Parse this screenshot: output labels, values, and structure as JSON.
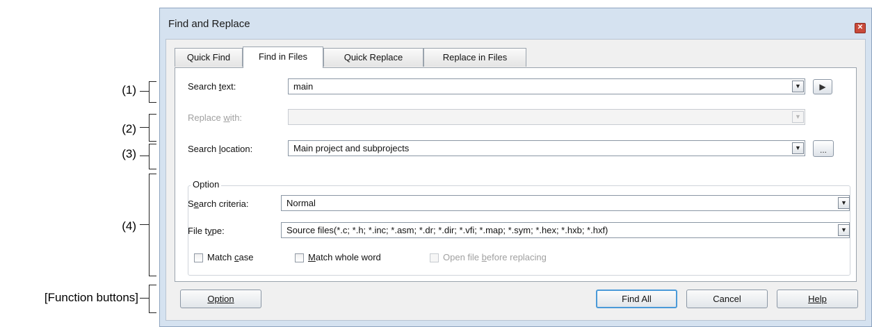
{
  "annotations": {
    "a1": "(1)",
    "a2": "(2)",
    "a3": "(3)",
    "a4": "(4)",
    "function_buttons": "[Function buttons]"
  },
  "window": {
    "title": "Find and Replace"
  },
  "tabs": [
    {
      "label": "Quick Find",
      "active": false
    },
    {
      "label": "Find in Files",
      "active": true
    },
    {
      "label": "Quick Replace",
      "active": false
    },
    {
      "label": "Replace in Files",
      "active": false
    }
  ],
  "search_text": {
    "label": "Search text:",
    "value": "main"
  },
  "replace_with": {
    "label": "Replace with:",
    "value": "",
    "disabled": true
  },
  "search_location": {
    "label": "Search location:",
    "value": "Main project and subprojects"
  },
  "option_group": {
    "title": "Option",
    "search_criteria": {
      "label": "Search criteria:",
      "value": "Normal"
    },
    "file_type": {
      "label": "File type:",
      "value": "Source files(*.c; *.h; *.inc; *.asm; *.dr; *.dir; *.vfi; *.map; *.sym; *.hex; *.hxb; *.hxf)"
    },
    "match_case": {
      "label": "Match case",
      "checked": false
    },
    "match_whole_word": {
      "label": "Match whole word",
      "checked": false
    },
    "open_file_before_replacing": {
      "label": "Open file before replacing",
      "checked": false,
      "disabled": true
    }
  },
  "buttons": {
    "option": "Option",
    "find_all": "Find All",
    "cancel": "Cancel",
    "help": "Help"
  },
  "colors": {
    "accent": "#4a9ad8",
    "window_frame": "#d5e2f0",
    "close_button": "#c94a3a"
  }
}
